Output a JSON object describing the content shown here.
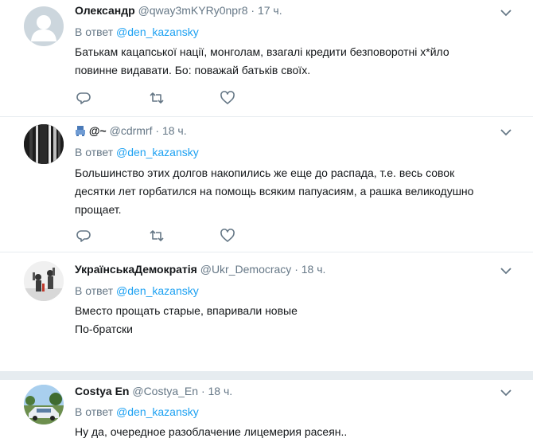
{
  "tweets": [
    {
      "name": "Олександр",
      "name_icon": "",
      "handle": "@qway3mKYRy0npr8",
      "dot": "·",
      "time": "17 ч.",
      "reply_prefix": "В ответ ",
      "reply_mention": "@den_kazansky",
      "lines": [
        "Батькам кацапської нації, монголам, взагалі кредити безповоротні х*йло",
        "повинне видавати. Бо: поважай батьків своїх."
      ],
      "avatar": "default-silhouette"
    },
    {
      "name": "@~",
      "name_icon": "robot-emoji-icon",
      "handle": "@cdrmrf",
      "dot": "·",
      "time": "18 ч.",
      "reply_prefix": "В ответ ",
      "reply_mention": "@den_kazansky",
      "lines": [
        "Большинство этих долгов накопились же еще до распада, т.е. весь совок",
        "десятки лет горбатился на помощь всяким папуасиям, а рашка великодушно",
        "прощает."
      ],
      "avatar": "striped-pattern"
    },
    {
      "name": "УкраїнськаДемократія",
      "name_icon": "",
      "handle": "@Ukr_Democracy",
      "dot": "·",
      "time": "18 ч.",
      "reply_prefix": "В ответ ",
      "reply_mention": "@den_kazansky",
      "lines": [
        "Вместо прощать старые, впаривали новые",
        "По-братски"
      ],
      "avatar": "photo-figures"
    },
    {
      "name": "Costya En",
      "name_icon": "",
      "handle": "@Costya_En",
      "dot": "·",
      "time": "18 ч.",
      "reply_prefix": "В ответ ",
      "reply_mention": "@den_kazansky",
      "lines": [
        "Ну да, очередное разоблачение лицемерия расеян.."
      ],
      "avatar": "photo-car"
    }
  ],
  "colors": {
    "accent": "#1da1f2",
    "muted": "#657786",
    "border": "#e6ecf0"
  }
}
